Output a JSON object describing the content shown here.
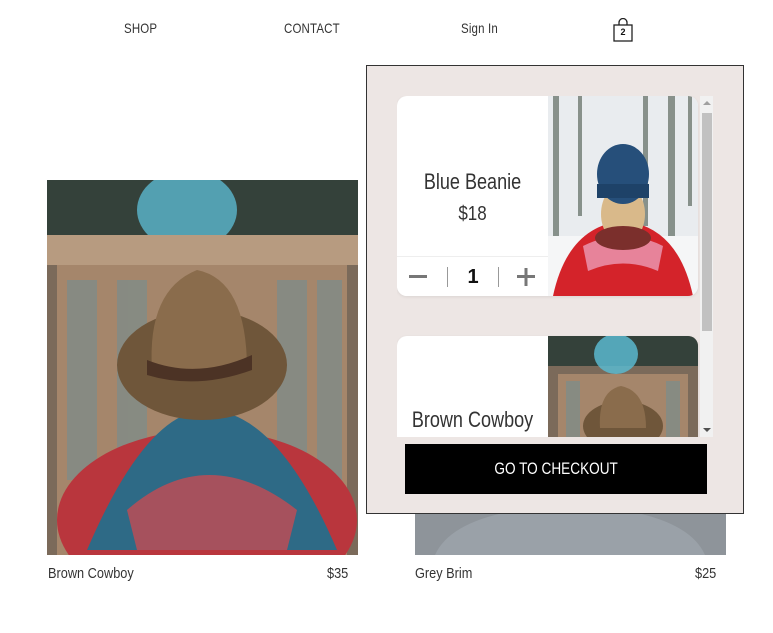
{
  "nav": {
    "shop": "SHOP",
    "contact": "CONTACT",
    "sign_in": "Sign In",
    "cart_icon": "shopping-bag-icon",
    "cart_count": "2"
  },
  "products": [
    {
      "name": "Brown Cowboy",
      "price": "$35"
    },
    {
      "name": "Grey Brim",
      "price": "$25"
    }
  ],
  "cart": {
    "items": [
      {
        "name": "Blue Beanie",
        "price": "$18",
        "quantity": "1",
        "decrease_icon": "minus-icon",
        "increase_icon": "plus-icon"
      },
      {
        "name": "Brown Cowboy"
      }
    ],
    "checkout_label": "GO TO CHECKOUT"
  },
  "colors": {
    "cart_background": "#ede6e4",
    "checkout_button": "#000000"
  }
}
